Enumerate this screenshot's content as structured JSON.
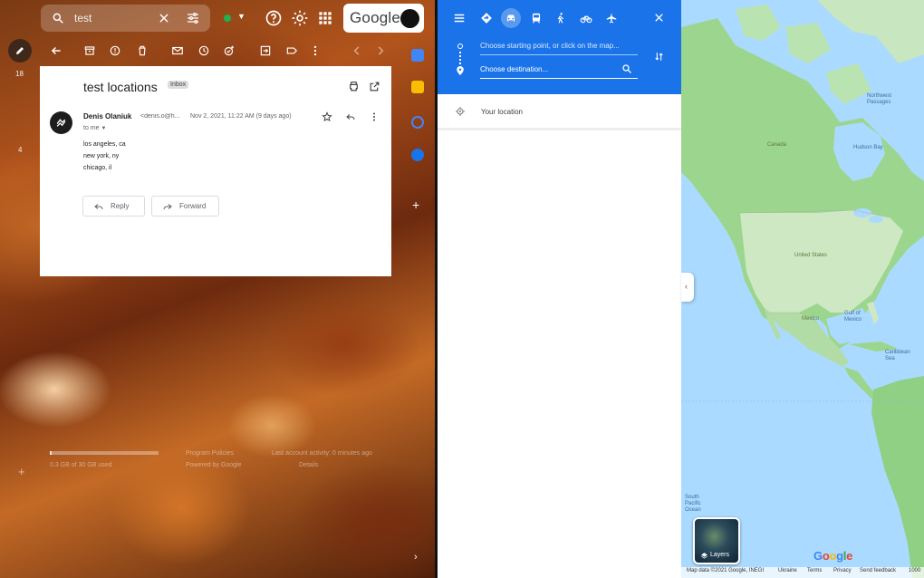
{
  "gmail": {
    "search": {
      "query": "test"
    },
    "google_badge": "Google",
    "side_counts": [
      "18",
      "4"
    ],
    "message": {
      "subject": "test locations",
      "label": "Inbox",
      "sender_name": "Denis Olaniuk",
      "sender_email": "<denis.o@h...",
      "date": "Nov 2, 2021, 11:22 AM (9 days ago)",
      "to": "to me",
      "body": [
        "los angeles, ca",
        "new york, ny",
        "chicago, il"
      ]
    },
    "buttons": {
      "reply": "Reply",
      "forward": "Forward"
    },
    "footer": {
      "storage": "0.3 GB of 30 GB used",
      "storage_fraction": 0.01,
      "policies": "Program Policies",
      "powered": "Powered by Google",
      "activity": "Last account activity: 0 minutes ago",
      "details": "Details"
    },
    "colors": {
      "status_green": "#22b14c",
      "card_bg": "#ffffff"
    }
  },
  "maps": {
    "modes": [
      "best-route",
      "driving",
      "transit",
      "walking",
      "cycling",
      "flights"
    ],
    "active_mode": "driving",
    "start_placeholder": "Choose starting point, or click on the map...",
    "destination_placeholder": "Choose destination...",
    "your_location": "Your location",
    "map_labels": {
      "canada": "Canada",
      "united_states": "United States",
      "mexico": "Mexico",
      "gulf_of_mexico": "Gulf of Mexico",
      "hudson_bay": "Hudson Bay",
      "northwest_passages": "Northwest Passages",
      "caribbean_sea": "Caribbean Sea",
      "south_pacific_ocean": "South Pacific Ocean"
    },
    "layers_label": "Layers",
    "google_logo": "Google",
    "footer": [
      "Map data ©2021 Google, INEGI",
      "Ukraine",
      "Terms",
      "Privacy",
      "Send feedback",
      "1000"
    ],
    "colors": {
      "header_blue": "#1a73e8",
      "land": "#aadf9a",
      "water": "#aadaff"
    }
  }
}
